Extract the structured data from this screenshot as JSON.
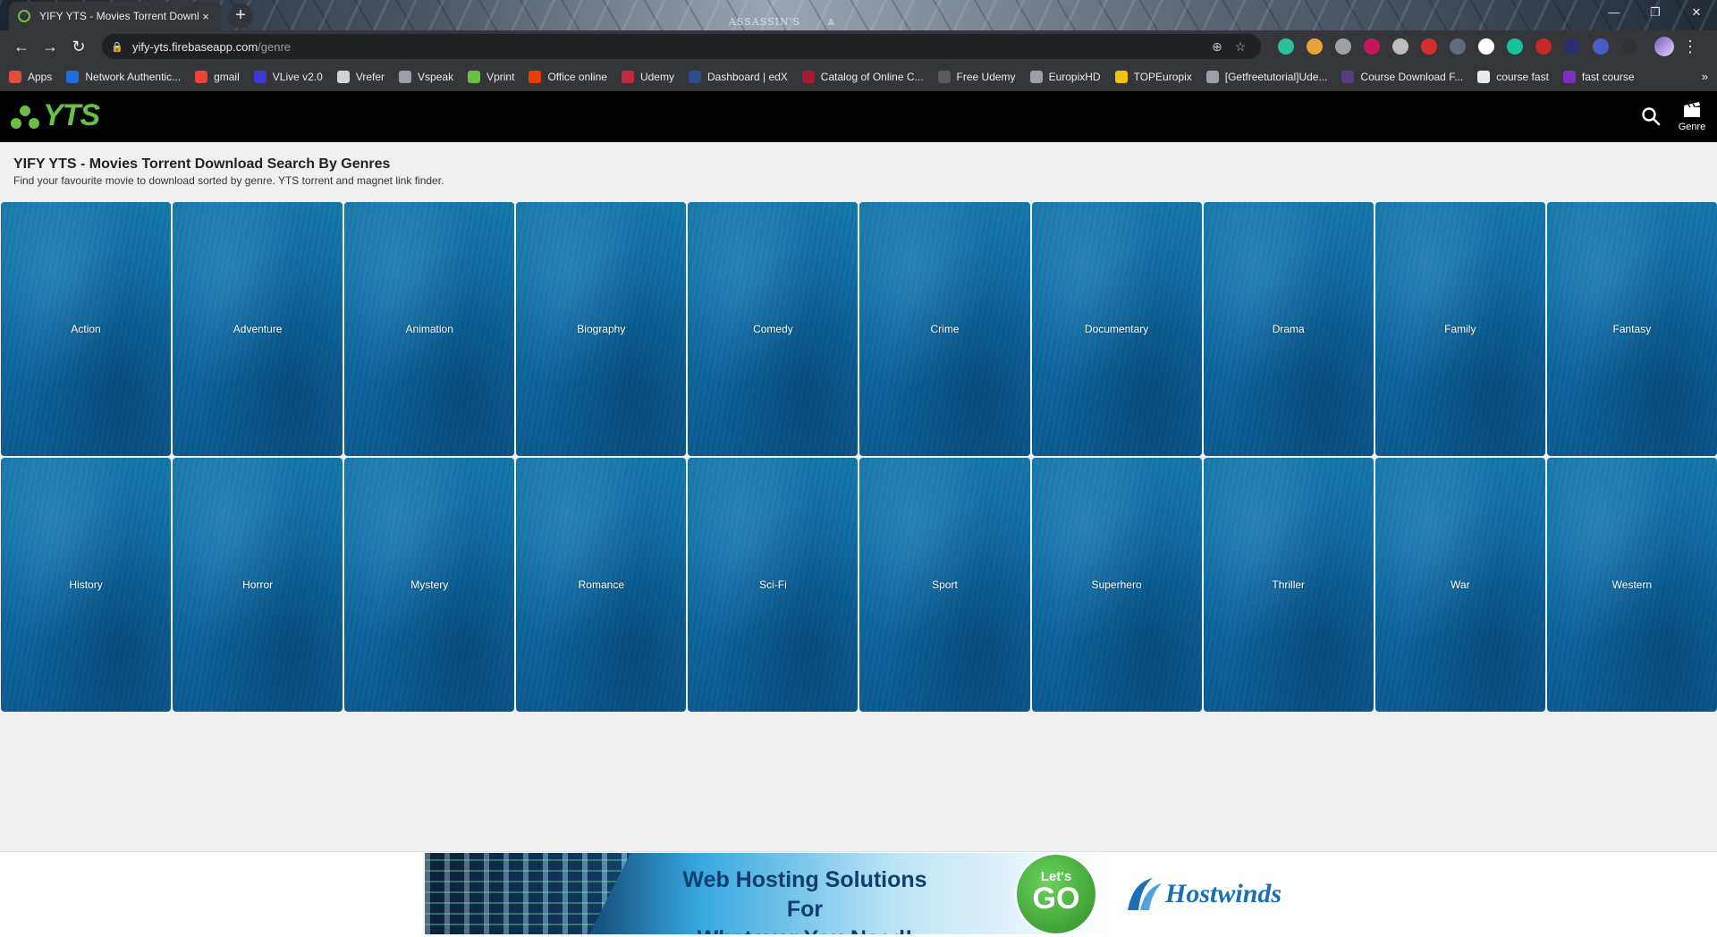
{
  "browser": {
    "tab_title": "YIFY YTS - Movies Torrent Downl",
    "tab_close": "×",
    "new_tab": "+",
    "title_logo": "ASSASSIN'S",
    "window_controls": {
      "minimize": "—",
      "restore": "❐",
      "close": "✕"
    },
    "nav": {
      "back": "←",
      "forward": "→",
      "reload": "↻"
    },
    "url_host": "yify-yts.firebaseapp.com",
    "url_path": "/genre",
    "omnibox_icons": {
      "install": "⊕",
      "star": "☆"
    },
    "menu": "⋮",
    "extensions": [
      "#2bbf9a",
      "#e8a33b",
      "#9aa0a6",
      "#c2185b",
      "#bdbdbd",
      "#d32f2f",
      "#5f6b7a",
      "#ffffff",
      "#15c39a",
      "#c62828",
      "#2b2d6e",
      "#4a5cc5",
      "#303134"
    ],
    "bookmarks_more": "»",
    "bookmarks": [
      {
        "label": "Apps",
        "color": "#e34b3b"
      },
      {
        "label": "Network Authentic...",
        "color": "#1e6fd9"
      },
      {
        "label": "gmail",
        "color": "#ea4335"
      },
      {
        "label": "VLive v2.0",
        "color": "#3b3bd1"
      },
      {
        "label": "Vrefer",
        "color": "#d0d4da"
      },
      {
        "label": "Vspeak",
        "color": "#9aa0a6"
      },
      {
        "label": "Vprint",
        "color": "#6ac045"
      },
      {
        "label": "Office online",
        "color": "#eb3c00"
      },
      {
        "label": "Udemy",
        "color": "#c5283d"
      },
      {
        "label": "Dashboard | edX",
        "color": "#2a4b8d"
      },
      {
        "label": "Catalog of Online C...",
        "color": "#a51c30"
      },
      {
        "label": "Free Udemy",
        "color": "#5a5a5a"
      },
      {
        "label": "EuropixHD",
        "color": "#9aa0a6"
      },
      {
        "label": "TOPEuropix",
        "color": "#f4c20d"
      },
      {
        "label": "[Getfreetutorial]Ude...",
        "color": "#9aa0a6"
      },
      {
        "label": "Course Download F...",
        "color": "#563d7c"
      },
      {
        "label": "course fast",
        "color": "#e8eaed"
      },
      {
        "label": "fast course",
        "color": "#7b2fbf"
      }
    ]
  },
  "site": {
    "logo_text": "YTS",
    "logo_color": "#6ac045",
    "header_genre_label": "Genre",
    "title": "YIFY YTS - Movies Torrent Download Search By Genres",
    "subtitle": "Find your favourite movie to download sorted by genre. YTS torrent and magnet link finder.",
    "genres": [
      "Action",
      "Adventure",
      "Animation",
      "Biography",
      "Comedy",
      "Crime",
      "Documentary",
      "Drama",
      "Family",
      "Fantasy",
      "History",
      "Horror",
      "Mystery",
      "Romance",
      "Sci-Fi",
      "Sport",
      "Superhero",
      "Thriller",
      "War",
      "Western"
    ]
  },
  "ad": {
    "headline_line1": "Web Hosting Solutions For",
    "headline_line2": "Whatever You Need!",
    "cta_small": "Let's",
    "cta_big": "GO",
    "brand": "Hostwinds"
  }
}
